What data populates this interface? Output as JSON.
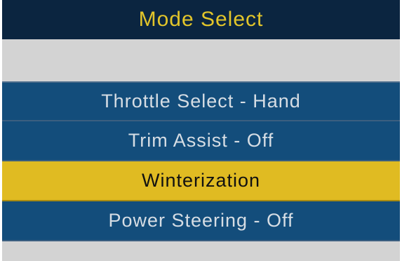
{
  "header": {
    "title": "Mode Select"
  },
  "menu": {
    "items": [
      {
        "label": "Throttle Select - Hand",
        "selected": false
      },
      {
        "label": "Trim Assist - Off",
        "selected": false
      },
      {
        "label": "Winterization",
        "selected": true
      },
      {
        "label": "Power Steering - Off",
        "selected": false
      }
    ]
  },
  "colors": {
    "header_bg": "#0b2540",
    "header_text": "#e2c52a",
    "item_bg": "#134d7b",
    "item_text": "#d6dde4",
    "selected_bg": "#e0bb22",
    "selected_text": "#111111",
    "band_bg": "#d3d3d3"
  }
}
